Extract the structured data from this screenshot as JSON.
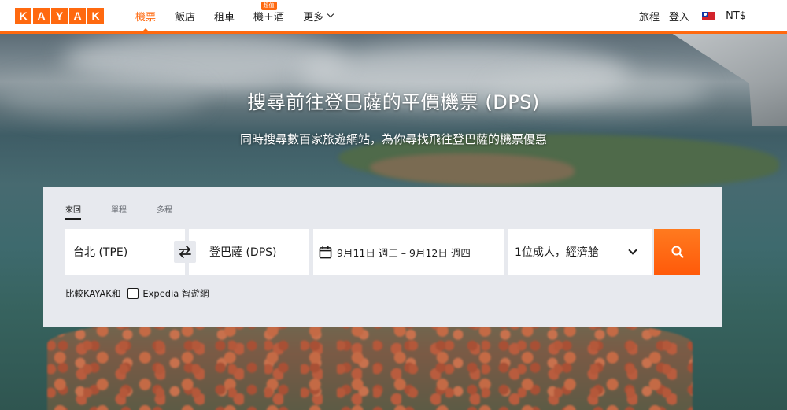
{
  "brand": {
    "logo_letters": [
      "K",
      "A",
      "Y",
      "A",
      "K"
    ],
    "accent": "#ff690f"
  },
  "nav": {
    "items": [
      {
        "label": "機票",
        "active": true
      },
      {
        "label": "飯店"
      },
      {
        "label": "租車"
      },
      {
        "label": "機＋酒",
        "badge": "超值"
      },
      {
        "label": "更多"
      }
    ],
    "right": {
      "trips": "旅程",
      "login": "登入",
      "currency": "NT$"
    }
  },
  "hero": {
    "title": "搜尋前往登巴薩的平價機票 (DPS)",
    "subtitle": "同時搜尋數百家旅遊網站，為你尋找飛往登巴薩的機票優惠"
  },
  "search": {
    "trip_types": [
      "來回",
      "單程",
      "多程"
    ],
    "active_trip_type": "來回",
    "origin": "台北 (TPE)",
    "destination": "登巴薩 (DPS)",
    "dates": "9月11日 週三 – 9月12日 週四",
    "passengers": "1位成人，經濟艙",
    "compare_label": "比較KAYAK和",
    "compare_option": "Expedia 智遊網"
  }
}
